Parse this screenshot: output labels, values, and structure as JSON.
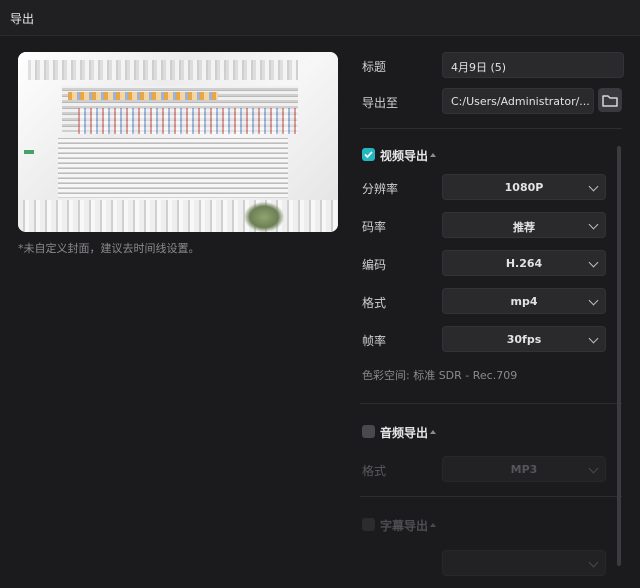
{
  "window": {
    "title": "导出"
  },
  "preview": {
    "note": "*未自定义封面，建议去时间线设置。"
  },
  "basic": {
    "title_label": "标题",
    "title_value": "4月9日 (5)",
    "export_to_label": "导出至",
    "export_path": "C:/Users/Administrator/..."
  },
  "video": {
    "header": "视频导出",
    "checked": true,
    "fields": [
      {
        "label": "分辨率",
        "value": "1080P"
      },
      {
        "label": "码率",
        "value": "推荐"
      },
      {
        "label": "编码",
        "value": "H.264"
      },
      {
        "label": "格式",
        "value": "mp4"
      },
      {
        "label": "帧率",
        "value": "30fps"
      }
    ],
    "color_space": "色彩空间:  标准 SDR - Rec.709"
  },
  "audio": {
    "header": "音频导出",
    "checked": false,
    "format_label": "格式",
    "format_value": "MP3"
  },
  "subtitle": {
    "header": "字幕导出",
    "checked": false
  },
  "colors": {
    "accent": "#23b8bf",
    "background": "#1b1b1d",
    "field": "#2a2a2d"
  },
  "icons": [
    "checkbox-checked-icon",
    "checkbox-icon",
    "chevron-down-icon",
    "folder-icon",
    "caret-up-icon"
  ]
}
